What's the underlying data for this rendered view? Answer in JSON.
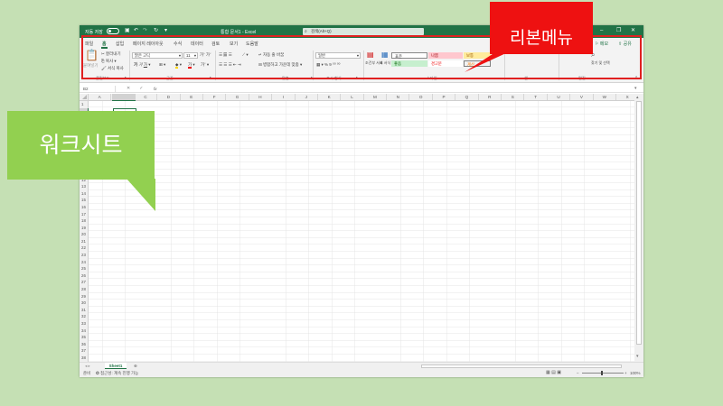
{
  "titlebar": {
    "autosave_label": "자동 저장",
    "doc_title": "통합 문서1 - Excel",
    "search_placeholder": "검색(Alt+Q)"
  },
  "tabs": [
    "파일",
    "홈",
    "삽입",
    "페이지 레이아웃",
    "수식",
    "데이터",
    "검토",
    "보기",
    "도움말"
  ],
  "active_tab": "홈",
  "ribbon_right": {
    "comment": "메모",
    "share": "공유"
  },
  "ribbon": {
    "clipboard": {
      "paste": "붙여넣기",
      "cut": "잘라내기",
      "copy": "복사",
      "format_painter": "서식 복사",
      "group": "클립보드"
    },
    "font": {
      "name": "맑은 고딕",
      "size": "11",
      "group": "글꼴"
    },
    "alignment": {
      "wrap": "자동 줄 바꿈",
      "merge": "병합하고 가운데 맞춤",
      "group": "맞춤"
    },
    "number": {
      "format": "일반",
      "group": "표시 형식"
    },
    "styles": {
      "cond_format": "조건부 서식",
      "table_format": "표 서식",
      "cells": [
        "표준",
        "나쁨",
        "보통",
        "좋음",
        "경고문",
        "계산"
      ],
      "group": "스타일"
    },
    "cells_group": "셀",
    "editing": {
      "find": "찾기 및 선택",
      "group": "편집"
    }
  },
  "formula_bar": {
    "name_box": "B2",
    "fx": "fx"
  },
  "columns": [
    "A",
    "B",
    "C",
    "D",
    "E",
    "F",
    "G",
    "H",
    "I",
    "J",
    "K",
    "L",
    "M",
    "N",
    "O",
    "P",
    "Q",
    "R",
    "S",
    "T",
    "U",
    "V",
    "W",
    "X"
  ],
  "rows": [
    "1",
    "2",
    "3",
    "4",
    "5",
    "6",
    "7",
    "8",
    "9",
    "10",
    "11",
    "12",
    "13",
    "14",
    "15",
    "16",
    "17",
    "18",
    "19",
    "20",
    "21",
    "22",
    "23",
    "24",
    "25",
    "26",
    "27",
    "28",
    "29",
    "30",
    "31",
    "32",
    "33",
    "34",
    "35",
    "36",
    "37",
    "38"
  ],
  "sheet_tab": "Sheet1",
  "status": {
    "ready": "준비",
    "accessibility": "접근성: 계속 진행 가능",
    "zoom": "100%"
  },
  "callouts": {
    "ribbon": "리본메뉴",
    "worksheet": "워크시트"
  },
  "colors": {
    "excel_green": "#217346",
    "background": "#c5e0b4",
    "ribbon_callout": "#ee1111",
    "sheet_callout": "#92d050"
  }
}
